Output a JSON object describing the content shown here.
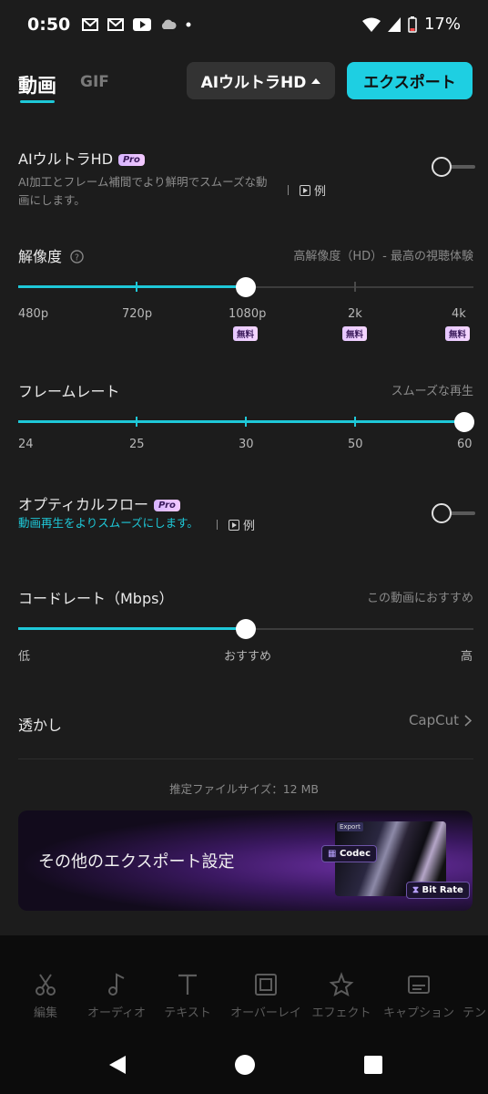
{
  "status_bar": {
    "time": "0:50",
    "battery": "17%"
  },
  "tabs": {
    "video": "動画",
    "gif": "GIF"
  },
  "header": {
    "ultra_button": "AIウルトラHD",
    "export_button": "エクスポート"
  },
  "ultra_hd": {
    "title": "AIウルトラHD",
    "pro_badge": "Pro",
    "description_line1": "AI加工とフレーム補間でより鮮明でスムーズな動",
    "description_line2": "画にします。",
    "example": "例",
    "enabled": false
  },
  "resolution": {
    "title": "解像度",
    "note": "高解像度（HD）- 最高の視聴体験",
    "options": [
      "480p",
      "720p",
      "1080p",
      "2k",
      "4k"
    ],
    "free_badge": "無料",
    "selected": "1080p"
  },
  "frame_rate": {
    "title": "フレームレート",
    "note": "スムーズな再生",
    "options": [
      "24",
      "25",
      "30",
      "50",
      "60"
    ],
    "selected": "60"
  },
  "optical_flow": {
    "title": "オプティカルフロー",
    "pro_badge": "Pro",
    "description": "動画再生をよりスムーズにします。",
    "example": "例",
    "enabled": false
  },
  "bitrate": {
    "title": "コードレート（Mbps）",
    "note": "この動画におすすめ",
    "labels": [
      "低",
      "おすすめ",
      "高"
    ],
    "selected": "おすすめ"
  },
  "watermark": {
    "title": "透かし",
    "value": "CapCut"
  },
  "estimated_size": "推定ファイルサイズ：12 MB",
  "banner": {
    "text": "その他のエクスポート設定",
    "export_tag": "Export",
    "codec_tag": "Codec",
    "bitrate_tag": "Bit Rate"
  },
  "bottom_nav": [
    "編集",
    "オーディオ",
    "テキスト",
    "オーバーレイ",
    "エフェクト",
    "キャプション",
    "テン"
  ],
  "colors": {
    "accent": "#1ec8d8",
    "background": "#1c1c1c"
  }
}
